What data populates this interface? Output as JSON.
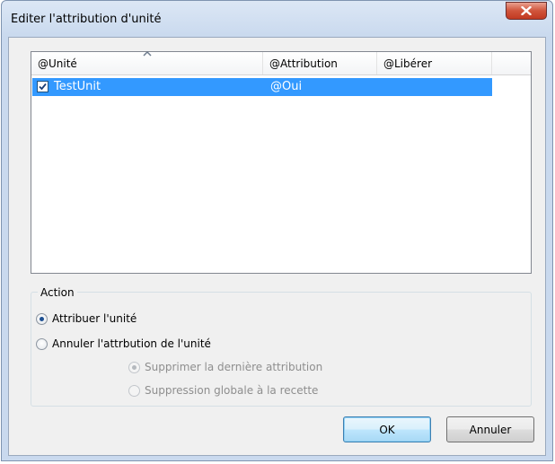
{
  "window": {
    "title": "Editer l'attribution d'unité"
  },
  "listview": {
    "columns": [
      "@Unité",
      "@Attribution",
      "@Libérer"
    ],
    "rows": [
      {
        "checked": true,
        "name": "TestUnit",
        "attribution": "@Oui",
        "liberer": ""
      }
    ]
  },
  "action": {
    "group_label": "Action",
    "options": [
      {
        "label": "Attribuer l'unité",
        "checked": true,
        "enabled": true
      },
      {
        "label": "Annuler l'attrbution de l'unité",
        "checked": false,
        "enabled": true
      },
      {
        "label": "Supprimer la dernière attribution",
        "checked": true,
        "enabled": false
      },
      {
        "label": "Suppression globale à la recette",
        "checked": false,
        "enabled": false
      }
    ]
  },
  "buttons": {
    "ok": "OK",
    "cancel": "Annuler"
  },
  "colors": {
    "selection": "#3399ff",
    "close": "#c23a22",
    "default_button": "#3c7fb1"
  },
  "icons": {
    "close": "close-x-icon",
    "sort": "sort-ascending-icon",
    "check": "checkmark-icon"
  }
}
